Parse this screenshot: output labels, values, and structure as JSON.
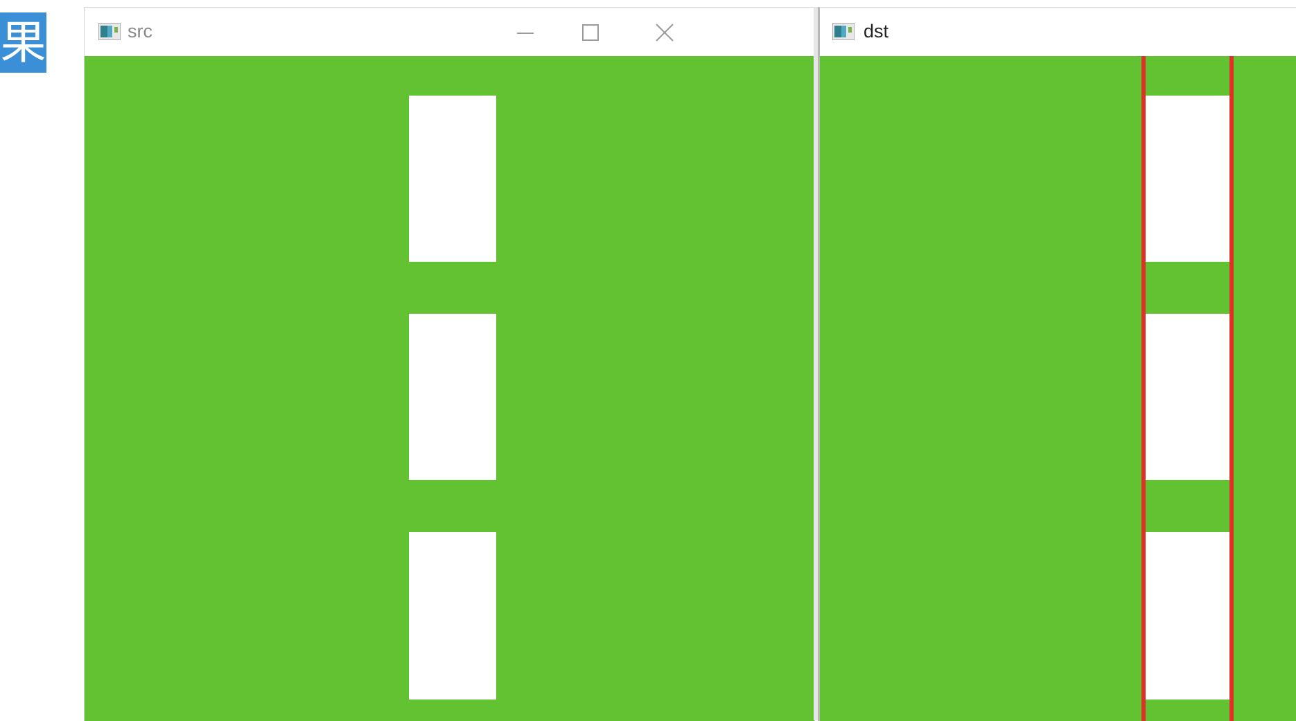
{
  "badge": {
    "text": "果"
  },
  "windows": {
    "src": {
      "title": "src"
    },
    "dst": {
      "title": "dst"
    }
  },
  "colors": {
    "image_background": "#62c232",
    "rectangles": "#ffffff",
    "boundary_lines": "#e03028",
    "badge": "#3a8fd6"
  },
  "icons": {
    "app": "opencv-window-icon",
    "minimize": "minimize-icon",
    "maximize": "maximize-icon",
    "close": "close-icon"
  }
}
